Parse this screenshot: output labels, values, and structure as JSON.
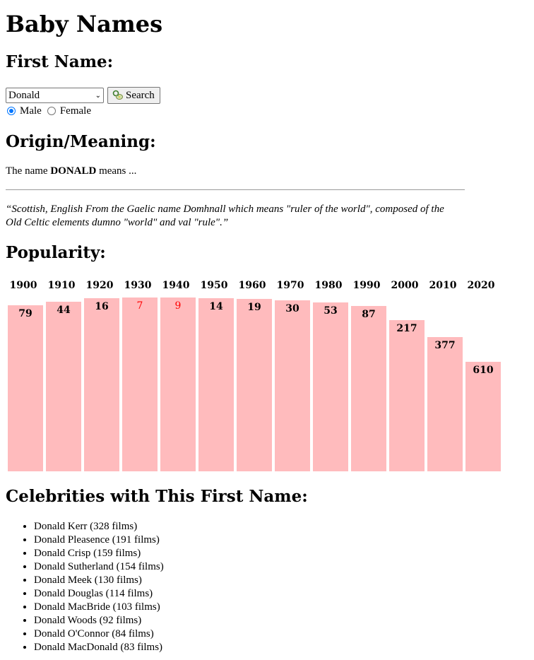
{
  "title": "Baby Names",
  "search": {
    "heading": "First Name:",
    "selected_name": "Donald",
    "button_label": "Search",
    "genders": [
      {
        "label": "Male",
        "checked": true
      },
      {
        "label": "Female",
        "checked": false
      }
    ]
  },
  "origin": {
    "heading": "Origin/Meaning:",
    "prefix": "The name ",
    "name": "DONALD",
    "suffix": " means ...",
    "quote": "“Scottish, English From the Gaelic name Domhnall which means \"ruler of the world\", composed of the Old Celtic elements dumno \"world\" and val \"rule\".”"
  },
  "popularity": {
    "heading": "Popularity:"
  },
  "chart_data": {
    "type": "bar",
    "categories": [
      "1900",
      "1910",
      "1920",
      "1930",
      "1940",
      "1950",
      "1960",
      "1970",
      "1980",
      "1990",
      "2000",
      "2010",
      "2020"
    ],
    "values": [
      79,
      44,
      16,
      7,
      9,
      14,
      19,
      30,
      53,
      87,
      217,
      377,
      610
    ],
    "value_meaning": "rank (lower is more popular)",
    "highlight_color": "#ff0000",
    "highlight_rule": "rank below 10",
    "bar_color": "#ffbbbd"
  },
  "celebrities": {
    "heading": "Celebrities with This First Name:",
    "items": [
      "Donald Kerr (328 films)",
      "Donald Pleasence (191 films)",
      "Donald Crisp (159 films)",
      "Donald Sutherland (154 films)",
      "Donald Meek (130 films)",
      "Donald Douglas (114 films)",
      "Donald MacBride (103 films)",
      "Donald Woods (92 films)",
      "Donald O'Connor (84 films)",
      "Donald MacDonald (83 films)"
    ]
  }
}
